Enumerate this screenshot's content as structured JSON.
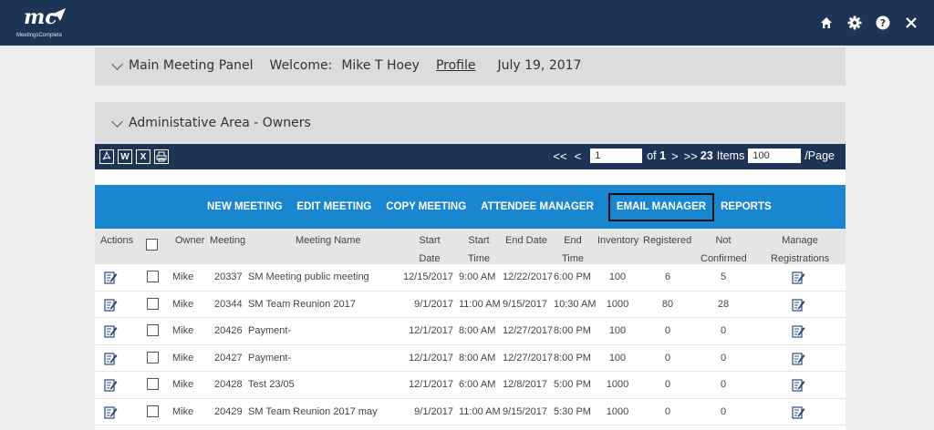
{
  "app": {
    "logo_text": "mc",
    "logo_subtext": "MeetingsComplete"
  },
  "top_icons": [
    "home-icon",
    "gear-icon",
    "help-icon",
    "close-icon"
  ],
  "main_panel": {
    "title": "Main Meeting Panel",
    "welcome": "Welcome:",
    "user": "Mike T Hoey",
    "profile": "Profile",
    "date": "July 19, 2017"
  },
  "admin_panel": {
    "title": "Administative Area - Owners"
  },
  "export": {
    "pdf": "",
    "word": "W",
    "excel": "X",
    "print": ""
  },
  "pager": {
    "first": "<<",
    "prev": "<",
    "page": "1",
    "of_label": "of",
    "total_pages": "1",
    "next": ">",
    "last": ">>",
    "items_count": "23",
    "items_label": "Items",
    "per_page": "100",
    "per_page_label": "/Page"
  },
  "actions": {
    "new_meeting": "NEW MEETING",
    "edit_meeting": "EDIT MEETING",
    "copy_meeting": "COPY MEETING",
    "attendee_manager": "ATTENDEE MANAGER",
    "email_manager": "EMAIL MANAGER",
    "reports": "REPORTS"
  },
  "columns": {
    "actions": "Actions",
    "owner": "Owner",
    "meeting": "Meeting",
    "meeting_name": "Meeting Name",
    "start_date_1": "Start",
    "start_date_2": "Date",
    "start_time_1": "Start",
    "start_time_2": "Time",
    "end_date": "End Date",
    "end_time_1": "End",
    "end_time_2": "Time",
    "inventory": "Inventory",
    "registered": "Registered",
    "not_confirmed_1": "Not",
    "not_confirmed_2": "Confirmed",
    "manage_1": "Manage",
    "manage_2": "Registrations"
  },
  "rows": [
    {
      "owner": "Mike",
      "meeting": "20337",
      "name": "SM Meeting public meeting",
      "start_date": "12/15/2017",
      "start_time": "9:00 AM",
      "end_date": "12/22/2017",
      "end_time": "6:00 PM",
      "inventory": "100",
      "registered": "6",
      "not_confirmed": "5"
    },
    {
      "owner": "Mike",
      "meeting": "20344",
      "name": "SM Team Reunion 2017",
      "start_date": "9/1/2017",
      "start_time": "11:00 AM",
      "end_date": "9/15/2017",
      "end_time": "10:30 AM",
      "inventory": "1000",
      "registered": "80",
      "not_confirmed": "28"
    },
    {
      "owner": "Mike",
      "meeting": "20426",
      "name": "Payment-",
      "start_date": "12/1/2017",
      "start_time": "8:00 AM",
      "end_date": "12/27/2017",
      "end_time": "8:00 PM",
      "inventory": "100",
      "registered": "0",
      "not_confirmed": "0"
    },
    {
      "owner": "Mike",
      "meeting": "20427",
      "name": "Payment-",
      "start_date": "12/1/2017",
      "start_time": "8:00 AM",
      "end_date": "12/27/2017",
      "end_time": "8:00 PM",
      "inventory": "100",
      "registered": "0",
      "not_confirmed": "0"
    },
    {
      "owner": "Mike",
      "meeting": "20428",
      "name": "Test 23/05",
      "start_date": "12/1/2017",
      "start_time": "6:00 AM",
      "end_date": "12/8/2017",
      "end_time": "5:00 PM",
      "inventory": "1000",
      "registered": "0",
      "not_confirmed": "0"
    },
    {
      "owner": "Mike",
      "meeting": "20429",
      "name": "SM Team Reunion 2017 may",
      "start_date": "9/1/2017",
      "start_time": "11:00 AM",
      "end_date": "9/15/2017",
      "end_time": "5:30 PM",
      "inventory": "1000",
      "registered": "0",
      "not_confirmed": "0"
    }
  ]
}
